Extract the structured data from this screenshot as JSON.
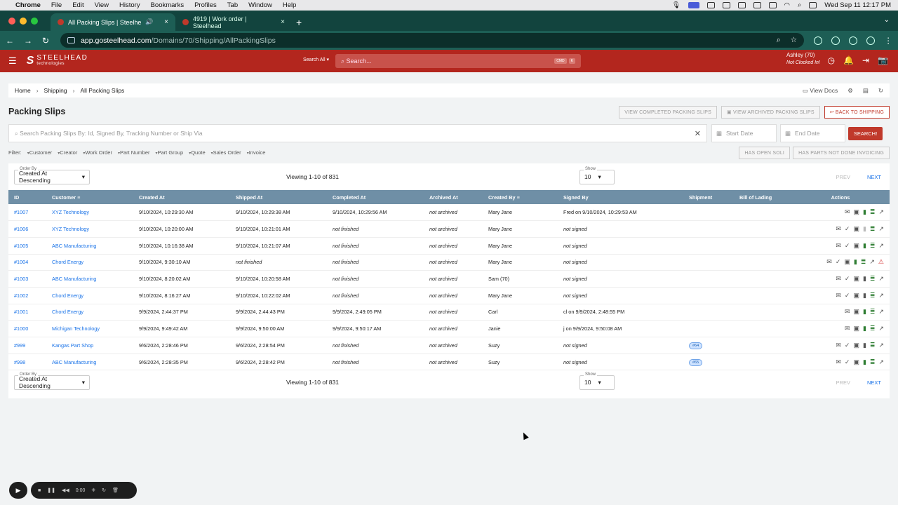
{
  "os_menubar": {
    "app": "Chrome",
    "items": [
      "File",
      "Edit",
      "View",
      "History",
      "Bookmarks",
      "Profiles",
      "Tab",
      "Window",
      "Help"
    ],
    "datetime": "Wed Sep 11  12:17 PM"
  },
  "browser": {
    "tabs": [
      {
        "title": "All Packing Slips | Steelhe",
        "active": true
      },
      {
        "title": "4919 | Work order | Steelhead",
        "active": false
      }
    ],
    "url_host": "app.gosteelhead.com",
    "url_path": "/Domains/70/Shipping/AllPackingSlips"
  },
  "app_header": {
    "brand": "STEELHEAD",
    "brand_sub": "technologies",
    "search_scope": "Search All",
    "search_placeholder": "Search...",
    "kbd": [
      "CMD",
      "K"
    ],
    "user_name": "Ashley (70)",
    "user_status": "Not Clocked In!"
  },
  "breadcrumb": {
    "items": [
      "Home",
      "Shipping",
      "All Packing Slips"
    ],
    "view_docs": "View Docs"
  },
  "page": {
    "title": "Packing Slips",
    "buttons": {
      "view_completed": "VIEW COMPLETED PACKING SLIPS",
      "view_archived": "VIEW ARCHIVED PACKING SLIPS",
      "back": "BACK TO SHIPPING"
    },
    "search_placeholder": "Search Packing Slips By: Id, Signed By, Tracking Number or Ship Via",
    "start_date": "Start Date",
    "end_date": "End Date",
    "search_button": "SEARCH!",
    "filter_label": "Filter:",
    "filters": [
      "Customer",
      "Creator",
      "Work Order",
      "Part Number",
      "Part Group",
      "Quote",
      "Sales Order",
      "Invoice"
    ],
    "toggle_chips": [
      "HAS OPEN SOLI",
      "HAS PARTS NOT DONE INVOICING"
    ]
  },
  "pager": {
    "order_by_label": "Order By",
    "order_by_value": "Created At Descending",
    "viewing": "Viewing 1-10 of 831",
    "show_label": "Show",
    "show_value": "10",
    "prev": "PREV",
    "next": "NEXT"
  },
  "table": {
    "columns": [
      "ID",
      "Customer",
      "Created At",
      "Shipped At",
      "Completed At",
      "Archived At",
      "Created By",
      "Signed By",
      "Shipment",
      "Bill of Lading",
      "Actions"
    ],
    "rows": [
      {
        "id": "#1007",
        "customer": "XYZ Technology",
        "created": "9/10/2024, 10:29:30 AM",
        "shipped": "9/10/2024, 10:29:38 AM",
        "completed": "9/10/2024, 10:29:56 AM",
        "archived": "not archived",
        "created_by": "Mary Jane",
        "signed_by": "Fred on 9/10/2024, 10:29:53 AM",
        "shipment": "",
        "bol": ""
      },
      {
        "id": "#1006",
        "customer": "XYZ Technology",
        "created": "9/10/2024, 10:20:00 AM",
        "shipped": "9/10/2024, 10:21:01 AM",
        "completed": "not finished",
        "archived": "not archived",
        "created_by": "Mary Jane",
        "signed_by": "not signed",
        "shipment": "",
        "bol": ""
      },
      {
        "id": "#1005",
        "customer": "ABC Manufacturing",
        "created": "9/10/2024, 10:16:38 AM",
        "shipped": "9/10/2024, 10:21:07 AM",
        "completed": "not finished",
        "archived": "not archived",
        "created_by": "Mary Jane",
        "signed_by": "not signed",
        "shipment": "",
        "bol": ""
      },
      {
        "id": "#1004",
        "customer": "Chord Energy",
        "created": "9/10/2024, 9:30:10 AM",
        "shipped": "not finished",
        "completed": "not finished",
        "archived": "not archived",
        "created_by": "Mary Jane",
        "signed_by": "not signed",
        "shipment": "",
        "bol": ""
      },
      {
        "id": "#1003",
        "customer": "ABC Manufacturing",
        "created": "9/10/2024, 8:20:02 AM",
        "shipped": "9/10/2024, 10:20:58 AM",
        "completed": "not finished",
        "archived": "not archived",
        "created_by": "Sam (70)",
        "signed_by": "not signed",
        "shipment": "",
        "bol": ""
      },
      {
        "id": "#1002",
        "customer": "Chord Energy",
        "created": "9/10/2024, 8:16:27 AM",
        "shipped": "9/10/2024, 10:22:02 AM",
        "completed": "not finished",
        "archived": "not archived",
        "created_by": "Mary Jane",
        "signed_by": "not signed",
        "shipment": "",
        "bol": ""
      },
      {
        "id": "#1001",
        "customer": "Chord Energy",
        "created": "9/9/2024, 2:44:37 PM",
        "shipped": "9/9/2024, 2:44:43 PM",
        "completed": "9/9/2024, 2:49:05 PM",
        "archived": "not archived",
        "created_by": "Carl",
        "signed_by": "cl on 9/9/2024, 2:48:55 PM",
        "shipment": "",
        "bol": ""
      },
      {
        "id": "#1000",
        "customer": "Michigan Technology",
        "created": "9/9/2024, 9:49:42 AM",
        "shipped": "9/9/2024, 9:50:00 AM",
        "completed": "9/9/2024, 9:50:17 AM",
        "archived": "not archived",
        "created_by": "Janie",
        "signed_by": "j on 9/9/2024, 9:50:08 AM",
        "shipment": "",
        "bol": ""
      },
      {
        "id": "#999",
        "customer": "Kangas Part Shop",
        "created": "9/6/2024, 2:28:46 PM",
        "shipped": "9/6/2024, 2:28:54 PM",
        "completed": "not finished",
        "archived": "not archived",
        "created_by": "Suzy",
        "signed_by": "not signed",
        "shipment": "#64",
        "bol": ""
      },
      {
        "id": "#998",
        "customer": "ABC Manufacturing",
        "created": "9/6/2024, 2:28:35 PM",
        "shipped": "9/6/2024, 2:28:42 PM",
        "completed": "not finished",
        "archived": "not archived",
        "created_by": "Suzy",
        "signed_by": "not signed",
        "shipment": "#65",
        "bol": ""
      }
    ]
  },
  "recorder": {
    "time": "0:00"
  }
}
